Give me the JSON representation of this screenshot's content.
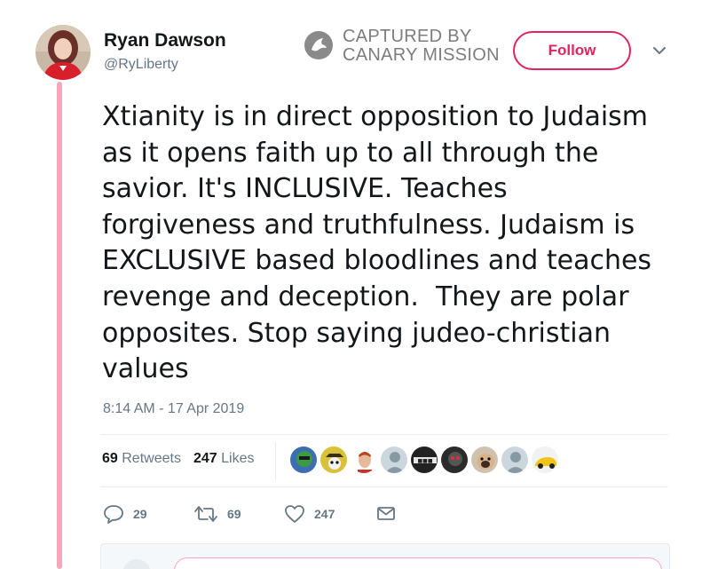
{
  "author": {
    "display_name": "Ryan Dawson",
    "handle": "@RyLiberty",
    "avatar_icon": "profile-photo-avatar"
  },
  "watermark": {
    "line1": "CAPTURED BY",
    "line2": "CANARY MISSION",
    "icon": "canary-logo-icon"
  },
  "follow_button": {
    "label": "Follow"
  },
  "menu_caret": {
    "icon": "chevron-down-icon"
  },
  "tweet": {
    "text": "Xtianity is in direct opposition to Judaism\nas it opens faith up to all through the\nsavior. It's INCLUSIVE. Teaches\nforgiveness and truthfulness. Judaism is\nEXCLUSIVE based bloodlines and teaches\nrevenge and deception.  They are polar\nopposites. Stop saying judeo-christian\nvalues",
    "timestamp": "8:14 AM - 17 Apr 2019"
  },
  "stats": {
    "retweets_count": "69",
    "retweets_label": "Retweets",
    "likes_count": "247",
    "likes_label": "Likes"
  },
  "actions": {
    "reply": {
      "count": "29",
      "icon": "reply-icon"
    },
    "retweet": {
      "count": "69",
      "icon": "retweet-icon"
    },
    "like": {
      "count": "247",
      "icon": "heart-icon"
    },
    "dm": {
      "icon": "envelope-icon"
    }
  },
  "colors": {
    "accent": "#e0245e",
    "thread_line": "#f4a6bd",
    "text": "#14171a",
    "muted": "#657786",
    "watermark": "#7d7d7d"
  }
}
